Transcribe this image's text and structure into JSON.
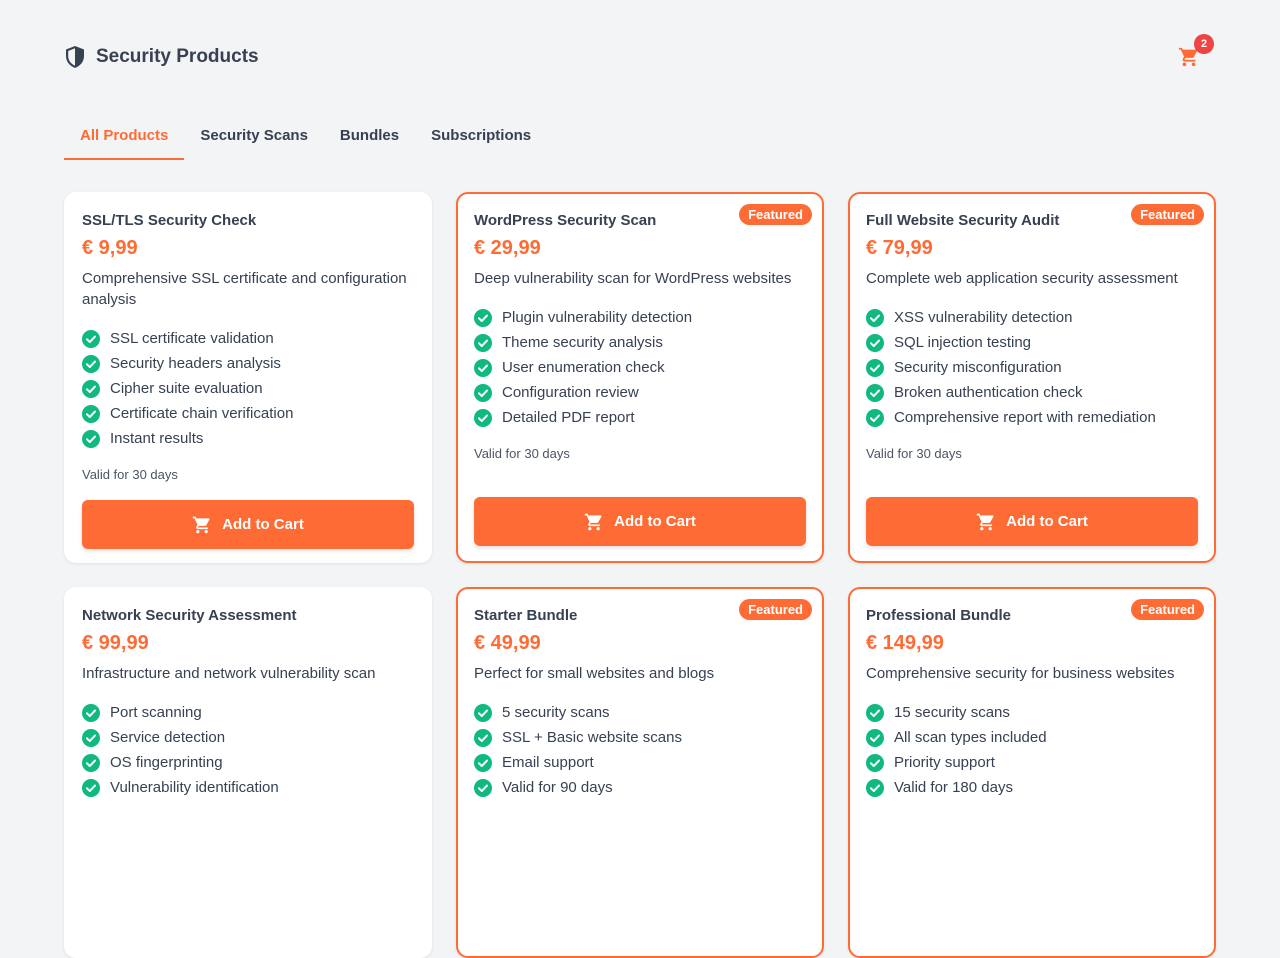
{
  "header": {
    "title": "Security Products",
    "logo_icon": "shield-icon",
    "cart_icon": "shopping-cart-icon",
    "cart_count": "2"
  },
  "tabs": [
    {
      "label": "All Products",
      "active": true
    },
    {
      "label": "Security Scans",
      "active": false
    },
    {
      "label": "Bundles",
      "active": false
    },
    {
      "label": "Subscriptions",
      "active": false
    }
  ],
  "featured_label": "Featured",
  "colors": {
    "accent": "#ff6b35",
    "check": "#10b981",
    "badge": "#ef4444"
  },
  "products": [
    {
      "title": "SSL/TLS Security Check",
      "price": "€ 9,99",
      "description": "Comprehensive SSL certificate and configuration analysis",
      "featured": false,
      "features": [
        "SSL certificate validation",
        "Security headers analysis",
        "Cipher suite evaluation",
        "Certificate chain verification",
        "Instant results"
      ],
      "validity": "Valid for 30 days",
      "button": "Add to Cart"
    },
    {
      "title": "WordPress Security Scan",
      "price": "€ 29,99",
      "description": "Deep vulnerability scan for WordPress websites",
      "featured": true,
      "features": [
        "Plugin vulnerability detection",
        "Theme security analysis",
        "User enumeration check",
        "Configuration review",
        "Detailed PDF report"
      ],
      "validity": "Valid for 30 days",
      "button": "Add to Cart"
    },
    {
      "title": "Full Website Security Audit",
      "price": "€ 79,99",
      "description": "Complete web application security assessment",
      "featured": true,
      "features": [
        "XSS vulnerability detection",
        "SQL injection testing",
        "Security misconfiguration",
        "Broken authentication check",
        "Comprehensive report with remediation"
      ],
      "validity": "Valid for 30 days",
      "button": "Add to Cart"
    },
    {
      "title": "Network Security Assessment",
      "price": "€ 99,99",
      "description": "Infrastructure and network vulnerability scan",
      "featured": false,
      "features": [
        "Port scanning",
        "Service detection",
        "OS fingerprinting",
        "Vulnerability identification"
      ],
      "validity": "",
      "button": ""
    },
    {
      "title": "Starter Bundle",
      "price": "€ 49,99",
      "description": "Perfect for small websites and blogs",
      "featured": true,
      "features": [
        "5 security scans",
        "SSL + Basic website scans",
        "Email support",
        "Valid for 90 days"
      ],
      "validity": "",
      "button": ""
    },
    {
      "title": "Professional Bundle",
      "price": "€ 149,99",
      "description": "Comprehensive security for business websites",
      "featured": true,
      "features": [
        "15 security scans",
        "All scan types included",
        "Priority support",
        "Valid for 180 days"
      ],
      "validity": "",
      "button": ""
    }
  ]
}
